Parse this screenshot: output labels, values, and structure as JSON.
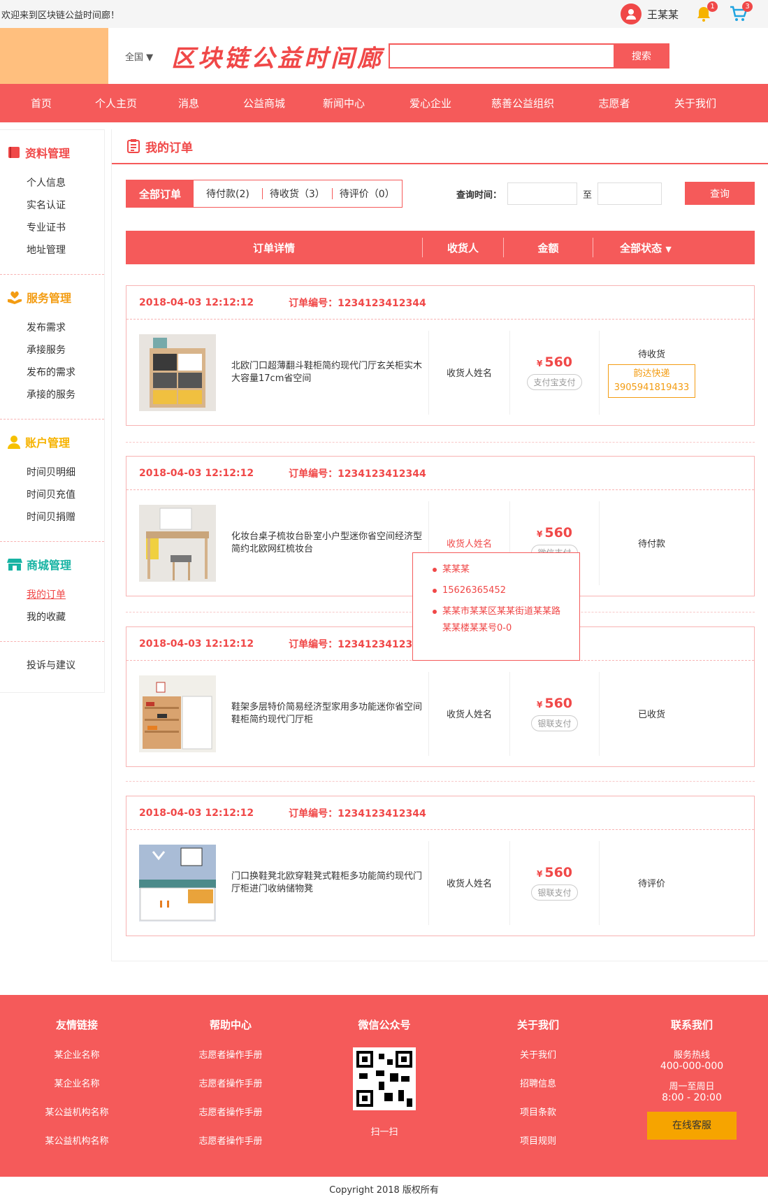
{
  "topbar": {
    "welcome": "欢迎来到区块链公益时间廊！",
    "user_name": "王某某",
    "notif_count": "1",
    "cart_count": "3"
  },
  "header": {
    "region": "全国",
    "brand": "区块链公益时间廊",
    "search_placeholder": "",
    "search_button": "搜索"
  },
  "nav": [
    "首页",
    "个人主页",
    "消息",
    "公益商城",
    "新闻中心",
    "爱心企业",
    "慈善公益组织",
    "志愿者",
    "关于我们"
  ],
  "sidebar": {
    "groups": [
      {
        "title": "资料管理",
        "items": [
          "个人信息",
          "实名认证",
          "专业证书",
          "地址管理"
        ]
      },
      {
        "title": "服务管理",
        "items": [
          "发布需求",
          "承接服务",
          "发布的需求",
          "承接的服务"
        ]
      },
      {
        "title": "账户管理",
        "items": [
          "时间贝明细",
          "时间贝充值",
          "时间贝捐赠"
        ]
      },
      {
        "title": "商城管理",
        "items": [
          "我的订单",
          "我的收藏"
        ]
      }
    ],
    "extra": "投诉与建议"
  },
  "main": {
    "title": "我的订单",
    "tabs": [
      "全部订单",
      "待付款(2)",
      "待收货（3）",
      "待评价（0）"
    ],
    "query_label": "查询时间：",
    "to_label": "至",
    "query_button": "查询",
    "columns": [
      "订单详情",
      "收货人",
      "金额",
      "全部状态"
    ]
  },
  "orders": [
    {
      "date": "2018-04-03 12:12:12",
      "order_no": "订单编号：1234123412344",
      "name": "北欧门口超薄翻斗鞋柜简约现代门厅玄关柜实木大容量17cm省空间",
      "receiver": "收货人姓名",
      "currency": "¥",
      "price": "560",
      "pay": "支付宝支付",
      "status": "待收货",
      "express_name": "韵达快递",
      "express_no": "3905941819433"
    },
    {
      "date": "2018-04-03 12:12:12",
      "order_no": "订单编号：1234123412344",
      "name": "化妆台桌子梳妆台卧室小户型迷你省空间经济型简约北欧网红梳妆台",
      "receiver": "收货人姓名",
      "currency": "¥",
      "price": "560",
      "pay": "微信支付",
      "status": "待付款"
    },
    {
      "date": "2018-04-03 12:12:12",
      "order_no": "订单编号：1234123412344",
      "name": "鞋架多层特价简易经济型家用多功能迷你省空间鞋柜简约现代门厅柜",
      "receiver": "收货人姓名",
      "currency": "¥",
      "price": "560",
      "pay": "银联支付",
      "status": "已收货"
    },
    {
      "date": "2018-04-03 12:12:12",
      "order_no": "订单编号：1234123412344",
      "name": "门口换鞋凳北欧穿鞋凳式鞋柜多功能简约现代门厅柜进门收纳储物凳",
      "receiver": "收货人姓名",
      "currency": "¥",
      "price": "560",
      "pay": "银联支付",
      "status": "待评价"
    }
  ],
  "popup": {
    "name": "某某某",
    "phone": "15626365452",
    "address": "某某市某某区某某街道某某路某某楼某某号0-0"
  },
  "footer": {
    "links_title": "友情链接",
    "links": [
      "某企业名称",
      "某企业名称",
      "某公益机构名称",
      "某公益机构名称"
    ],
    "help_title": "帮助中心",
    "help": [
      "志愿者操作手册",
      "志愿者操作手册",
      "志愿者操作手册",
      "志愿者操作手册"
    ],
    "wechat_title": "微信公众号",
    "wechat_caption": "扫一扫",
    "about_title": "关于我们",
    "about": [
      "关于我们",
      "招聘信息",
      "项目条款",
      "项目规则"
    ],
    "contact_title": "联系我们",
    "hotline_label": "服务热线",
    "hotline": "400-000-000",
    "hours_label": "周一至周日",
    "hours": "8:00 - 20:00",
    "service_button": "在线客服"
  },
  "copyright": "Copyright 2018 版权所有"
}
